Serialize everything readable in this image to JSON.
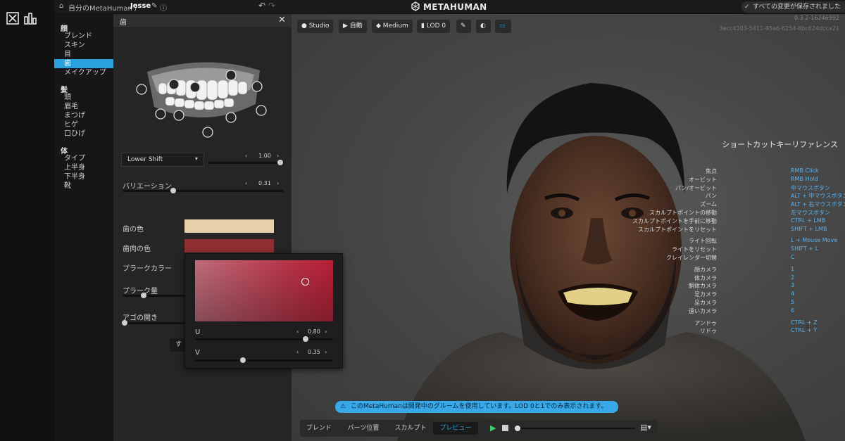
{
  "app": {
    "logo": "METAHUMAN"
  },
  "breadcrumb": {
    "root": "自分のMetaHuman /",
    "current": "Jesse"
  },
  "save_status": "すべての変更が保存されました",
  "version": {
    "line1": "0.3.2-16246992",
    "line2": "3ecc4103-5411-85a6-6254-8bc624dcca21"
  },
  "nav": {
    "groups": [
      {
        "title": "顔",
        "items": [
          "ブレンド",
          "スキン",
          "目",
          "歯",
          "メイクアップ"
        ]
      },
      {
        "title": "髪",
        "items": [
          "頭",
          "眉毛",
          "まつげ",
          "ヒゲ",
          "口ひげ"
        ]
      },
      {
        "title": "体",
        "items": [
          "タイプ",
          "上半身",
          "下半身",
          "靴"
        ]
      }
    ],
    "selected": "歯"
  },
  "panel": {
    "title": "歯",
    "shift_dropdown": "Lower Shift",
    "shift_value": "1.00",
    "variation_label": "バリエーション",
    "variation_value": "0.31",
    "tooth_color_label": "歯の色",
    "gum_color_label": "歯肉の色",
    "plaque_color_label": "プラークカラー",
    "plaque_amount_label": "プラーク量",
    "jaw_open_label": "アゴの開き",
    "reset_label": "す",
    "tooth_color": "#E6CFAA",
    "gum_color": "#8E2E33"
  },
  "color_picker": {
    "u_label": "U",
    "u_value": "0.80",
    "v_label": "V",
    "v_value": "0.35"
  },
  "viewport_toolbar": [
    "Studio",
    "自動",
    "Medium",
    "LOD 0"
  ],
  "shortcuts": {
    "title": "ショートカットキーリファレンス",
    "rows": [
      {
        "key": "焦点",
        "value": "RMB Click"
      },
      {
        "key": "オービット",
        "value": "RMB Hold"
      },
      {
        "key": "パン/オービット",
        "value": "中マウスボタン"
      },
      {
        "key": "パン",
        "value": "ALT + 中マウスボタン"
      },
      {
        "key": "ズーム",
        "value": "ALT + 右マウスボタン"
      },
      {
        "key": "スカルプトポイントの移動",
        "value": "左マウスボタン"
      },
      {
        "key": "スカルプトポイントを手前に移動",
        "value": "CTRL + LMB"
      },
      {
        "key": "スカルプトポイントをリセット",
        "value": "SHIFT + LMB"
      },
      {
        "key": "ライト回転",
        "value": "L + Mouse Move"
      },
      {
        "key": "ライトをリセット",
        "value": "SHIFT + L"
      },
      {
        "key": "クレイレンダー切替",
        "value": "C"
      },
      {
        "key": "顔カメラ",
        "value": "1"
      },
      {
        "key": "体カメラ",
        "value": "2"
      },
      {
        "key": "胴体カメラ",
        "value": "3"
      },
      {
        "key": "足カメラ",
        "value": "4"
      },
      {
        "key": "足カメラ",
        "value": "5"
      },
      {
        "key": "遠いカメラ",
        "value": "6"
      },
      {
        "key": "アンドゥ",
        "value": "CTRL + Z"
      },
      {
        "key": "リドゥ",
        "value": "CTRL + Y"
      }
    ]
  },
  "notice": "このMetaHumanは開発中のグルームを使用しています。LOD 0と1でのみ表示されます。",
  "bottom_tabs": [
    "ブレンド",
    "パーツ位置",
    "スカルプト",
    "プレビュー"
  ],
  "active_tab": "プレビュー",
  "colors": {
    "accent": "#2AA0DC",
    "notice_bg": "#38A8E8"
  }
}
